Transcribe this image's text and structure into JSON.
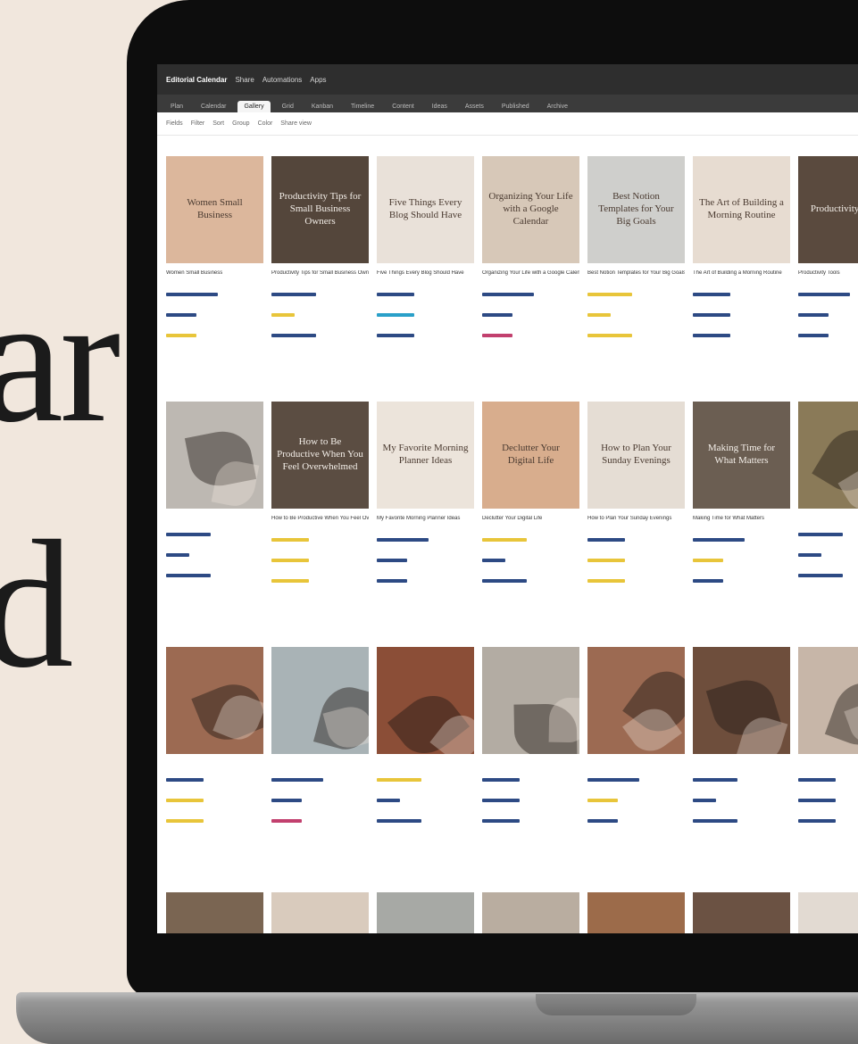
{
  "hero": {
    "line1": "ar",
    "line2": "d"
  },
  "app": {
    "title": "Editorial Calendar",
    "menu": [
      "Share",
      "Automations",
      "Apps"
    ],
    "tabs": [
      "Plan",
      "Calendar",
      "Gallery",
      "Grid",
      "Kanban",
      "Timeline",
      "Content",
      "Ideas",
      "Assets",
      "Published",
      "Archive"
    ],
    "active_tab": 2,
    "toolbar": [
      "Fields",
      "Filter",
      "Sort",
      "Group",
      "Color",
      "Share view"
    ]
  },
  "cards": [
    {
      "title": "Women Small Business",
      "bg": "#dcb79c",
      "tone": "light",
      "c1": "#2d4a84",
      "c2": "#2d4a84",
      "c3": "#e8c53a"
    },
    {
      "title": "Productivity Tips for Small Business Owners",
      "bg": "#54463b",
      "tone": "dark",
      "c1": "#2d4a84",
      "c2": "#e8c53a",
      "c3": "#2d4a84"
    },
    {
      "title": "Five Things Every Blog Should Have",
      "bg": "#e9e1d9",
      "tone": "light",
      "c1": "#2d4a84",
      "c2": "#2aa0c9",
      "c3": "#2d4a84"
    },
    {
      "title": "Organizing Your Life with a Google Calendar",
      "bg": "#d7c8b8",
      "tone": "light",
      "c1": "#2d4a84",
      "c2": "#2d4a84",
      "c3": "#c2406e"
    },
    {
      "title": "Best Notion Templates for Your Big Goals",
      "bg": "#cfcfcc",
      "tone": "light",
      "c1": "#e8c53a",
      "c2": "#e8c53a",
      "c3": "#e8c53a"
    },
    {
      "title": "The Art of Building a Morning Routine",
      "bg": "#e7dcd1",
      "tone": "light",
      "c1": "#2d4a84",
      "c2": "#2d4a84",
      "c3": "#2d4a84"
    },
    {
      "title": "Productivity Tools",
      "bg": "#5a4a3e",
      "tone": "dark",
      "c1": "#2d4a84",
      "c2": "#2d4a84",
      "c3": "#2d4a84"
    },
    {
      "title": "",
      "bg": "#bdb8b2",
      "tone": "dark",
      "c1": "#2d4a84",
      "c2": "#2d4a84",
      "c3": "#2d4a84"
    },
    {
      "title": "How to Be Productive When You Feel Overwhelmed",
      "bg": "#5b4d42",
      "tone": "dark",
      "c1": "#e8c53a",
      "c2": "#e8c53a",
      "c3": "#e8c53a"
    },
    {
      "title": "My Favorite Morning Planner Ideas",
      "bg": "#ece4db",
      "tone": "light",
      "c1": "#2d4a84",
      "c2": "#2d4a84",
      "c3": "#2d4a84"
    },
    {
      "title": "Declutter Your Digital Life",
      "bg": "#d8ad8d",
      "tone": "light",
      "c1": "#e8c53a",
      "c2": "#2d4a84",
      "c3": "#2d4a84"
    },
    {
      "title": "How to Plan Your Sunday Evenings",
      "bg": "#e5ddd4",
      "tone": "light",
      "c1": "#2d4a84",
      "c2": "#e8c53a",
      "c3": "#e8c53a"
    },
    {
      "title": "Making Time for What Matters",
      "bg": "#6b5e52",
      "tone": "dark",
      "c1": "#2d4a84",
      "c2": "#e8c53a",
      "c3": "#2d4a84"
    },
    {
      "title": "",
      "bg": "#8a7a58",
      "tone": "dark",
      "c1": "#2d4a84",
      "c2": "#2d4a84",
      "c3": "#2d4a84"
    },
    {
      "title": "",
      "bg": "#9c6a52",
      "tone": "dark",
      "c1": "#2d4a84",
      "c2": "#e8c53a",
      "c3": "#e8c53a"
    },
    {
      "title": "",
      "bg": "#a9b3b6",
      "tone": "dark",
      "c1": "#2d4a84",
      "c2": "#2d4a84",
      "c3": "#c2406e"
    },
    {
      "title": "",
      "bg": "#8b4e37",
      "tone": "dark",
      "c1": "#e8c53a",
      "c2": "#2d4a84",
      "c3": "#2d4a84"
    },
    {
      "title": "",
      "bg": "#b3aca3",
      "tone": "dark",
      "c1": "#2d4a84",
      "c2": "#2d4a84",
      "c3": "#2d4a84"
    },
    {
      "title": "",
      "bg": "#9c6a52",
      "tone": "dark",
      "c1": "#2d4a84",
      "c2": "#e8c53a",
      "c3": "#2d4a84"
    },
    {
      "title": "",
      "bg": "#6e4e3c",
      "tone": "dark",
      "c1": "#2d4a84",
      "c2": "#2d4a84",
      "c3": "#2d4a84"
    },
    {
      "title": "",
      "bg": "#c7b6a8",
      "tone": "dark",
      "c1": "#2d4a84",
      "c2": "#2d4a84",
      "c3": "#2d4a84"
    }
  ],
  "bottom_row_colors": [
    "#7a6552",
    "#d9cbbd",
    "#a7a9a5",
    "#b9ada0",
    "#9c6b4a",
    "#6b5243",
    "#e2dad2"
  ]
}
